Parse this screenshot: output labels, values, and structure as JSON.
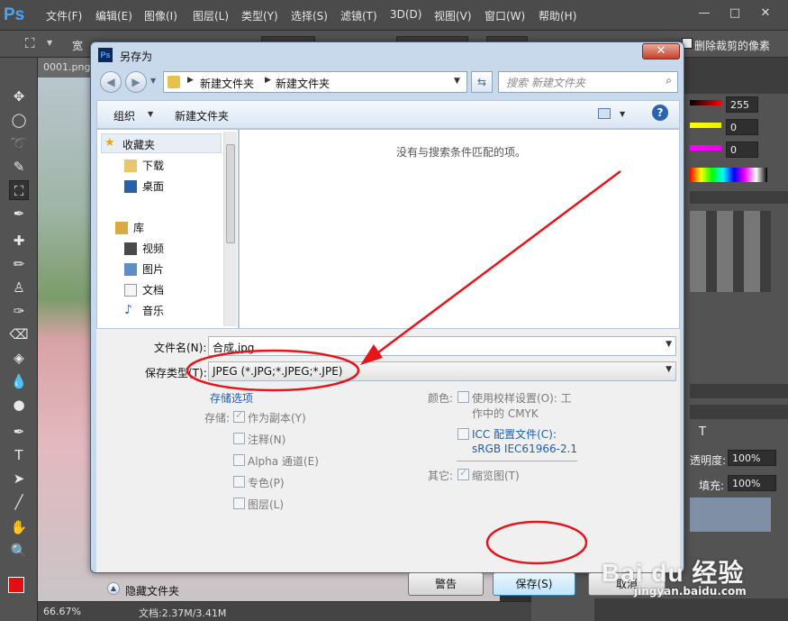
{
  "app": {
    "logo": "Ps"
  },
  "menu": [
    "文件(F)",
    "编辑(E)",
    "图像(I)",
    "图层(L)",
    "类型(Y)",
    "选择(S)",
    "滤镜(T)",
    "3D(D)",
    "视图(V)",
    "窗口(W)",
    "帮助(H)"
  ],
  "window_controls": {
    "minimize": "—",
    "maximize": "□",
    "close": "✕"
  },
  "options": {
    "width_label": "宽",
    "delete_cropped": "删除裁剪的像素"
  },
  "document": {
    "tab": "0001.png",
    "zoom": "66.67%",
    "docinfo": "文档:2.37M/3.41M"
  },
  "color_panel": {
    "values": [
      "255",
      "0",
      "0"
    ]
  },
  "layers_panel": {
    "opacity_label": "透明度:",
    "opacity": "100%",
    "fill_label": "填充:",
    "fill": "100%"
  },
  "dialog": {
    "title": "另存为",
    "close": "✕",
    "breadcrumb": [
      "新建文件夹",
      "新建文件夹"
    ],
    "search_placeholder": "搜索 新建文件夹",
    "organize": "组织",
    "new_folder": "新建文件夹",
    "empty_message": "没有与搜索条件匹配的项。",
    "nav": {
      "favorites": "收藏夹",
      "fav_items": [
        "下载",
        "桌面"
      ],
      "library": "库",
      "lib_items": [
        "视频",
        "图片",
        "文档",
        "音乐"
      ]
    },
    "filename_label": "文件名(N):",
    "filename": "合成.jpg",
    "filetype_label": "保存类型(T):",
    "filetype": "JPEG (*.JPG;*.JPEG;*.JPE)",
    "save_options_title": "存储选项",
    "storage_label": "存储:",
    "as_copy": "作为副本(Y)",
    "notes": "注释(N)",
    "alpha": "Alpha 通道(E)",
    "spot": "专色(P)",
    "layers": "图层(L)",
    "color_label": "颜色:",
    "use_proof_1": "使用校样设置(O): 工",
    "use_proof_2": "作中的 CMYK",
    "icc_1": "ICC 配置文件(C):",
    "icc_2": "sRGB IEC61966-2.1",
    "other_label": "其它:",
    "thumbnail": "缩览图(T)",
    "hide_folders": "隐藏文件夹",
    "warning": "警告",
    "save": "保存(S)",
    "cancel": "取消"
  },
  "watermark": {
    "brand": "Bai du 经验",
    "url": "jingyan.baidu.com"
  },
  "colors": {
    "annotation": "#e8141b",
    "link": "#1a5fb4",
    "fg_swatch": "#e01010",
    "bg_swatch": "#f2a089"
  }
}
